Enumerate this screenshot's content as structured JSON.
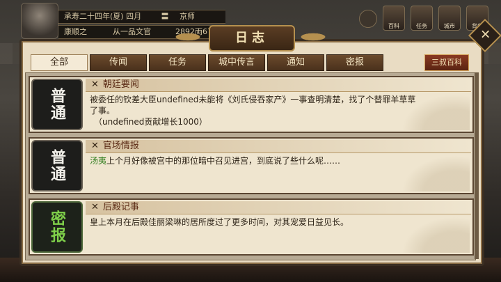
{
  "hud": {
    "line1_a": "承寿二十四年(夏) 四月",
    "line1_b": "〓",
    "line1_c": "京师",
    "line2_a": "康顺之",
    "line2_b": "从一品文官",
    "line2_c": "2892両67",
    "icons": [
      {
        "name": "hud-icon-1",
        "label": "百科"
      },
      {
        "name": "hud-icon-2",
        "label": "任务"
      },
      {
        "name": "hud-icon-3",
        "label": "城市"
      },
      {
        "name": "hud-icon-4",
        "label": "背包"
      }
    ]
  },
  "panel": {
    "title": "日志",
    "close_glyph": "✕"
  },
  "tabs": [
    {
      "label": "全部",
      "active": true
    },
    {
      "label": "传闻",
      "active": false
    },
    {
      "label": "任务",
      "active": false
    },
    {
      "label": "城中传言",
      "active": false
    },
    {
      "label": "通知",
      "active": false
    },
    {
      "label": "密报",
      "active": false
    }
  ],
  "wiki_button": "三叔百科",
  "entries": [
    {
      "badge": "普通",
      "x": "✕",
      "title": "朝廷要闻",
      "body": "被委任的钦差大臣undefined未能将《刘氏侵吞家产》一事查明清楚，找了个替罪羊草草了事。",
      "body2": "（undefined贡献增长1000）"
    },
    {
      "badge": "普通",
      "x": "✕",
      "title": "官场情报",
      "name": "汤夷",
      "body": "上个月好像被宫中的那位暗中召见进宫，到底说了些什么呢……"
    },
    {
      "badge": "密报",
      "x": "✕",
      "title": "后殿记事",
      "body": "皇上本月在后殿佳丽梁琳的居所度过了更多时间，对其宠爱日益见长。"
    }
  ],
  "colors": {
    "accent": "#b5904f",
    "secret_badge": "#7fd04a",
    "name_highlight": "#2f7d1d"
  }
}
